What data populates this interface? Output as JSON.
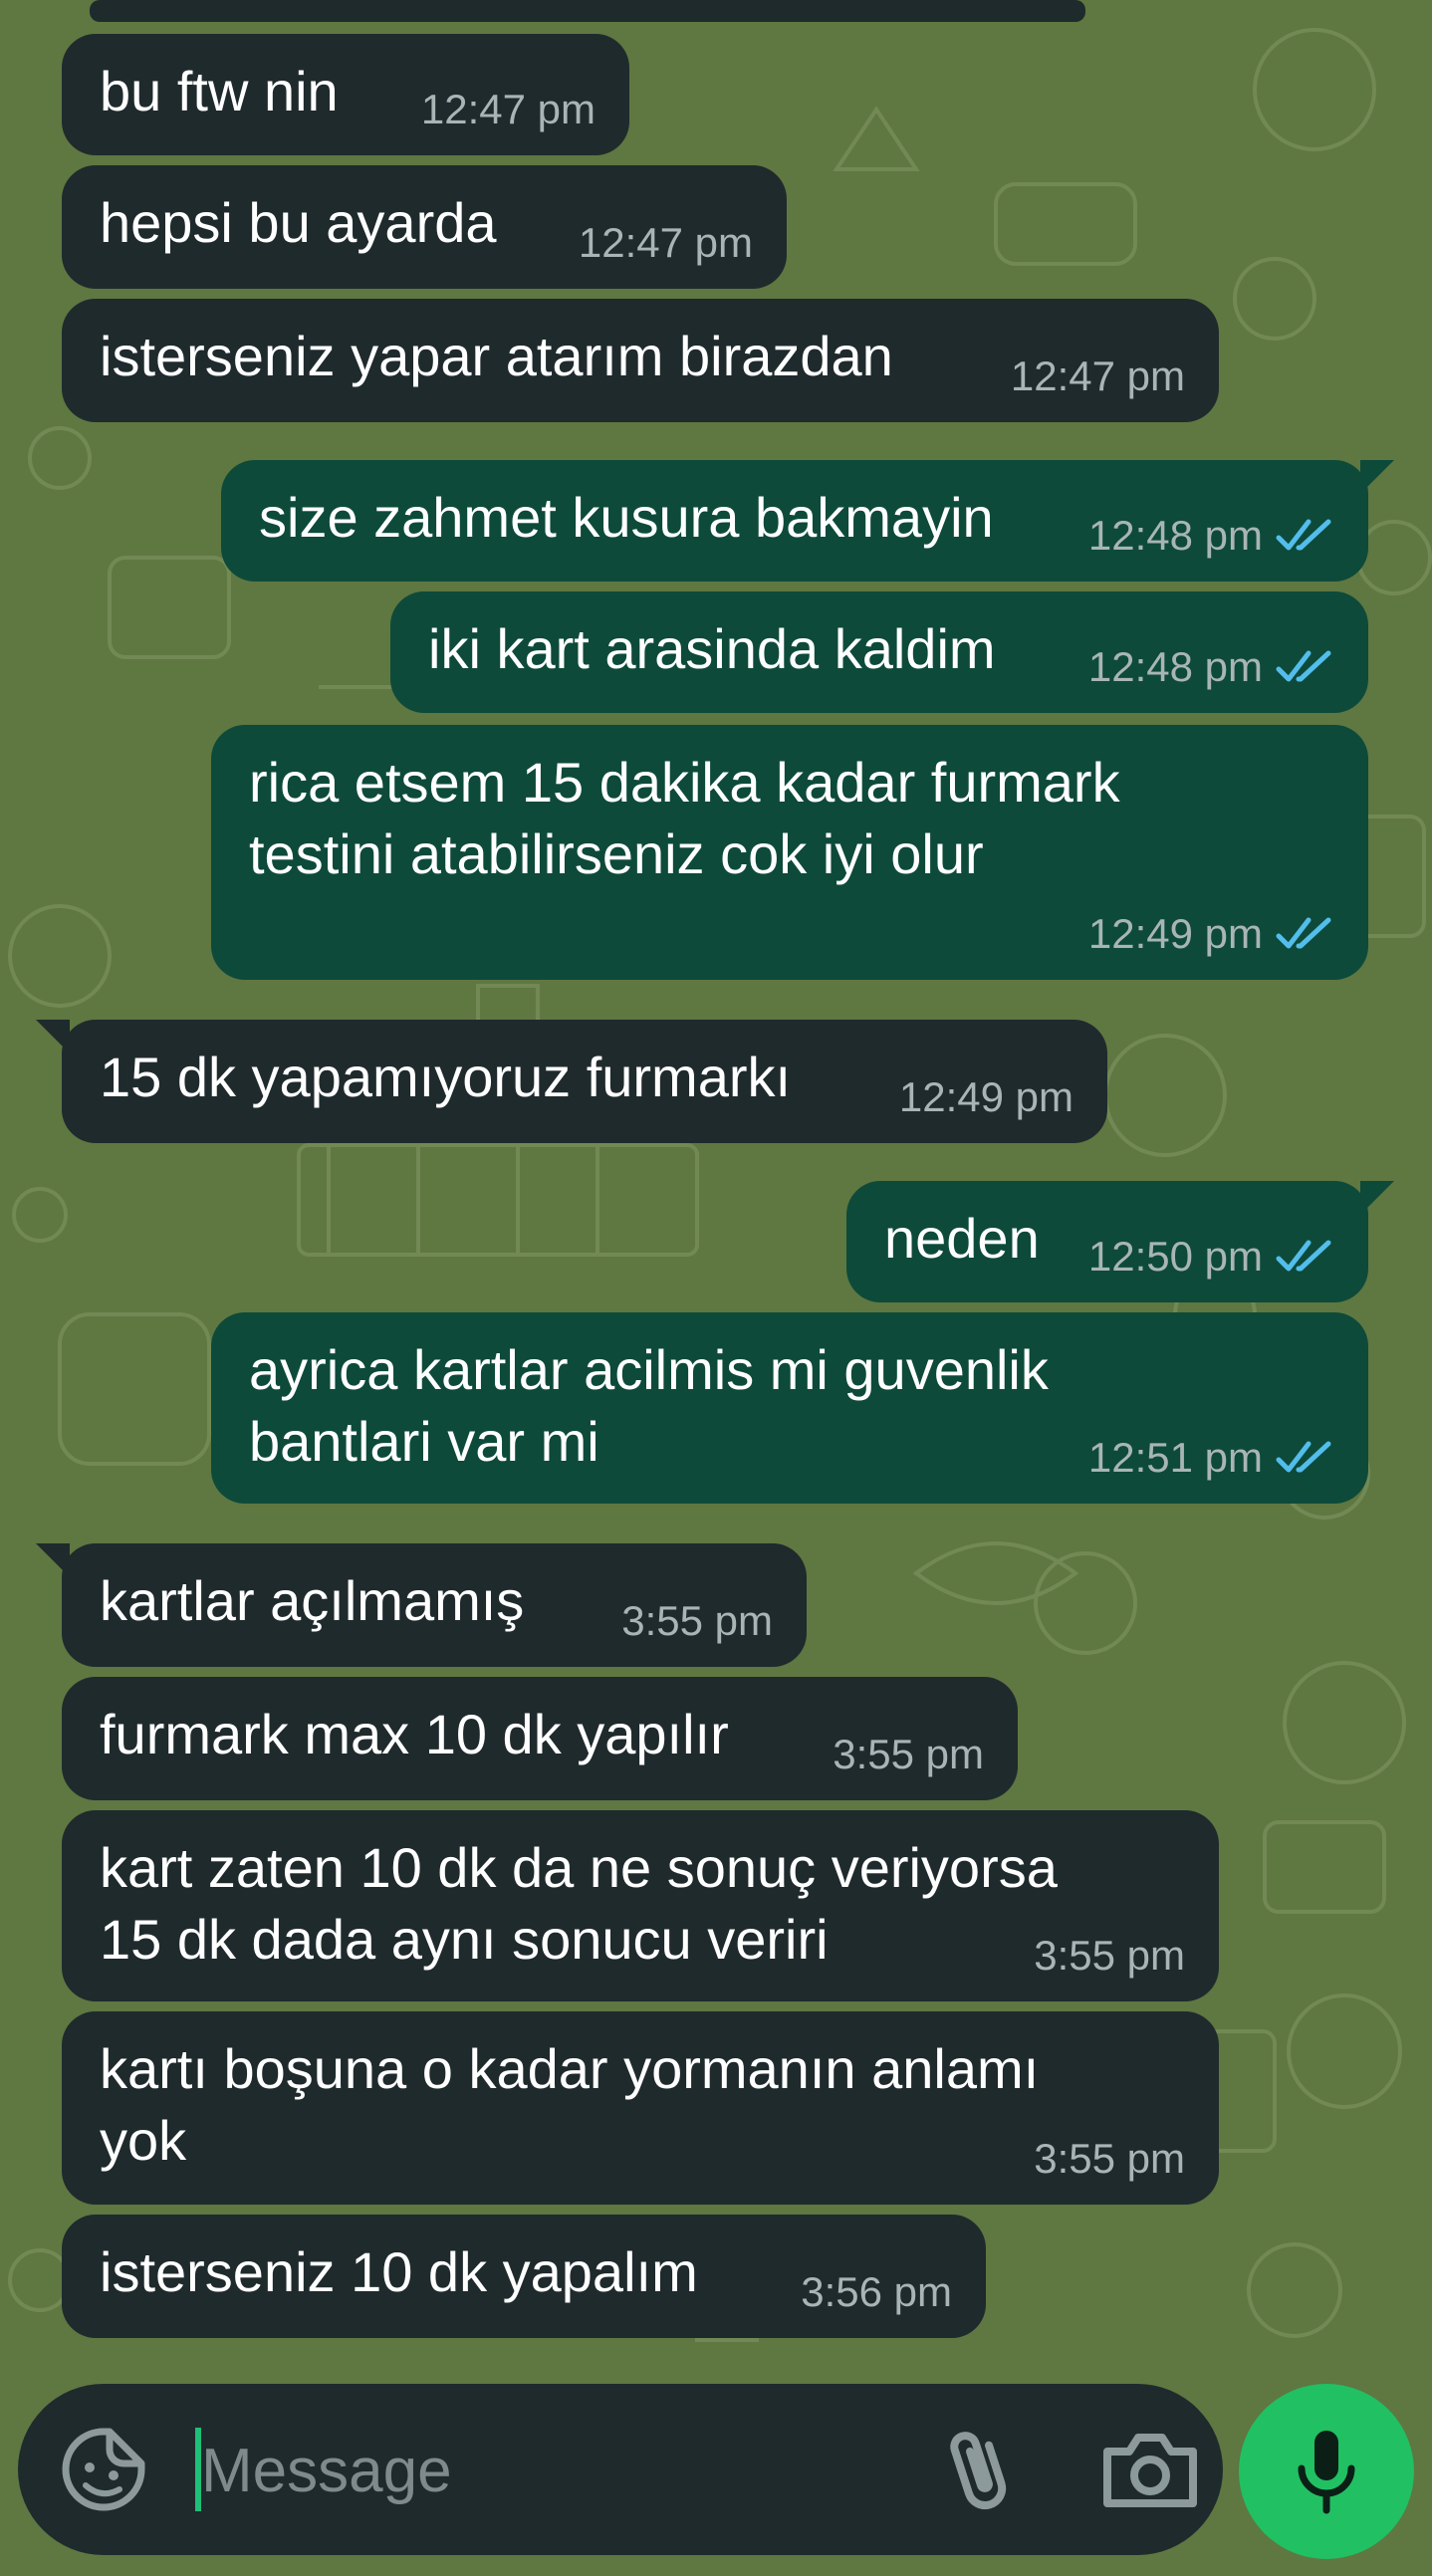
{
  "messages": [
    {
      "dir": "in",
      "text": "bu ftw nin",
      "time": "12:47 pm"
    },
    {
      "dir": "in",
      "text": "hepsi bu ayarda",
      "time": "12:47 pm"
    },
    {
      "dir": "in",
      "text": "isterseniz yapar atarım birazdan",
      "time": "12:47 pm"
    },
    {
      "dir": "out",
      "text": "size zahmet kusura bakmayin",
      "time": "12:48 pm",
      "status": "read"
    },
    {
      "dir": "out",
      "text": "iki kart arasinda kaldim",
      "time": "12:48 pm",
      "status": "read"
    },
    {
      "dir": "out",
      "text": "rica etsem 15 dakika kadar furmark\ntestini atabilirseniz cok iyi olur",
      "time": "12:49 pm",
      "status": "read"
    },
    {
      "dir": "in",
      "text": "15 dk yapamıyoruz furmarkı",
      "time": "12:49 pm"
    },
    {
      "dir": "out",
      "text": "neden",
      "time": "12:50 pm",
      "status": "read"
    },
    {
      "dir": "out",
      "text": "ayrica kartlar acilmis mi guvenlik\nbantlari var mi",
      "time": "12:51 pm",
      "status": "read"
    },
    {
      "dir": "in",
      "text": "kartlar açılmamış",
      "time": "3:55 pm"
    },
    {
      "dir": "in",
      "text": "furmark max 10 dk yapılır",
      "time": "3:55 pm"
    },
    {
      "dir": "in",
      "text": "kart zaten 10 dk da ne sonuç veriyorsa\n15 dk dada aynı sonucu veriri",
      "time": "3:55 pm"
    },
    {
      "dir": "in",
      "text": "kartı boşuna o kadar yormanın anlamı\nyok",
      "time": "3:55 pm"
    },
    {
      "dir": "in",
      "text": "isterseniz 10 dk yapalım",
      "time": "3:56 pm"
    }
  ],
  "composer": {
    "placeholder": "Message",
    "icons": {
      "emoji": "sticker-icon",
      "attach": "paperclip-icon",
      "camera": "camera-icon",
      "send": "microphone-icon"
    }
  },
  "colors": {
    "wallpaper": "#5f7741",
    "incoming_bubble": "#1f2a2d",
    "outgoing_bubble": "#0d4a3a",
    "timestamp": "#a9b5b5",
    "read_ticks": "#53bdeb",
    "accent": "#21c063"
  }
}
